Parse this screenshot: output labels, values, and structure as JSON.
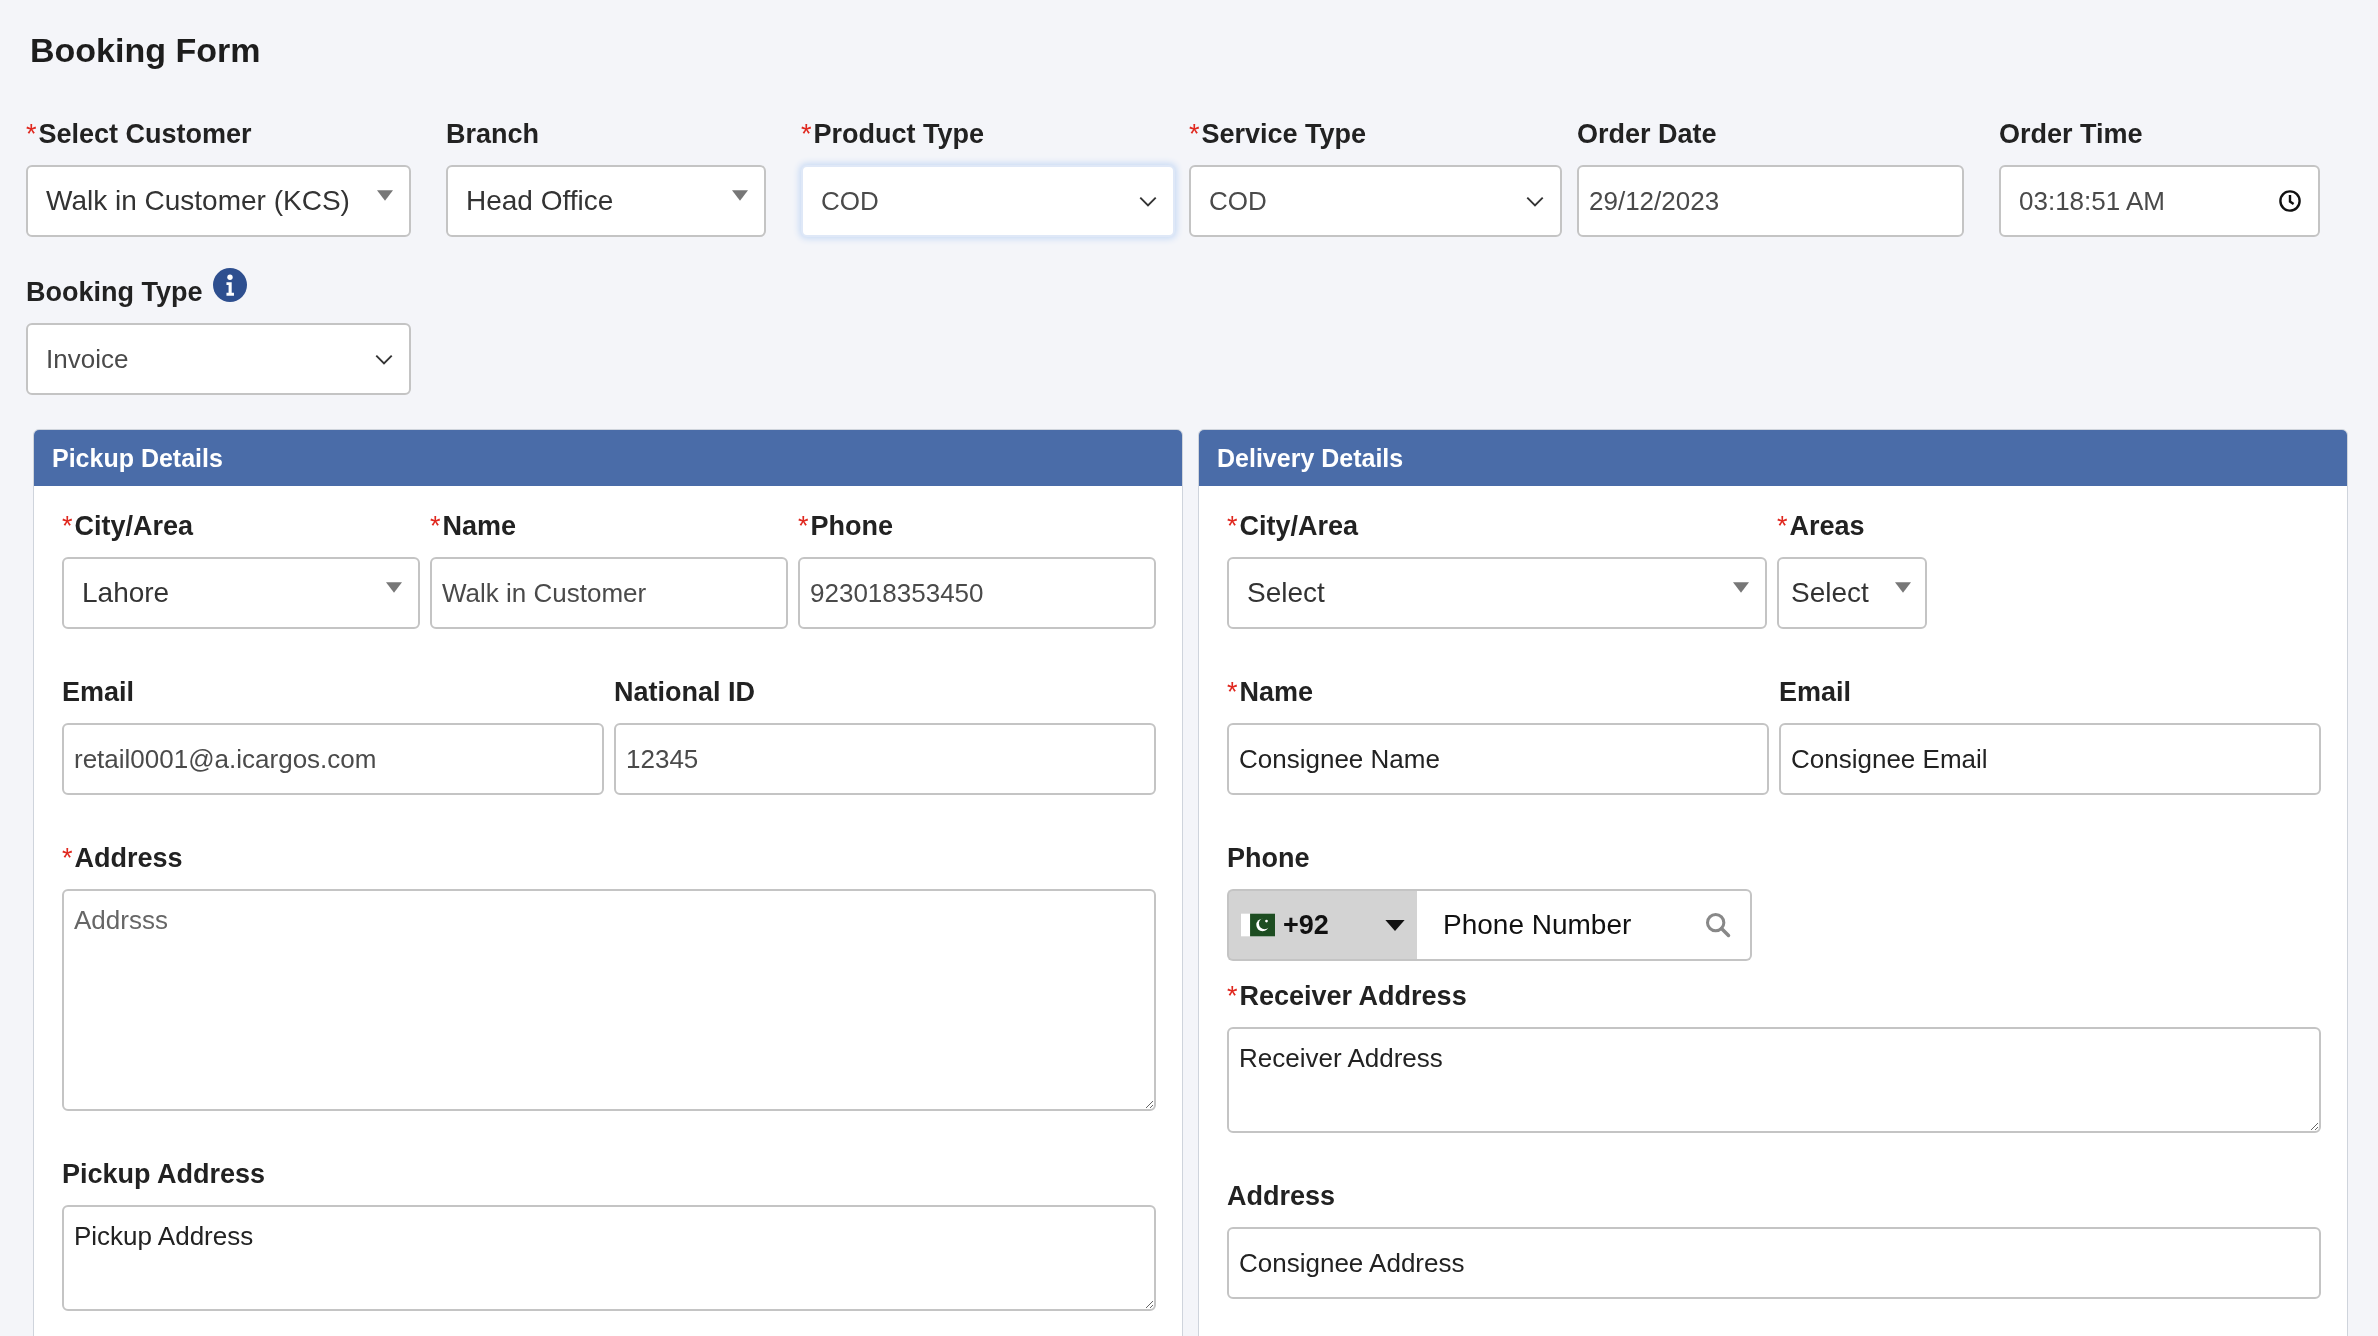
{
  "title": "Booking Form",
  "header_fields": [
    {
      "label": "Select Customer",
      "mark": "*",
      "kind": "dropdown",
      "value": "Walk in Customer (KCS)",
      "focused": false,
      "info": false
    },
    {
      "label": "Branch",
      "kind": "dropdown",
      "value": "Head Office",
      "focused": false,
      "info": false
    },
    {
      "label": "Product Type",
      "mark": "*",
      "kind": "select",
      "value": "COD",
      "focused": true,
      "info": false
    },
    {
      "label": "Service Type",
      "mark": "*",
      "kind": "select",
      "value": "COD",
      "focused": false,
      "info": false
    },
    {
      "label": "Order Date",
      "kind": "text",
      "value": "29/12/2023",
      "focused": false,
      "info": false
    },
    {
      "label": "Order Time",
      "kind": "time",
      "value": "03:18:51 AM",
      "focused": false,
      "info": false
    },
    {
      "label": "Booking Type",
      "kind": "select",
      "value": "Invoice",
      "focused": false,
      "info": true
    }
  ],
  "panels": [
    {
      "title": "Pickup Details",
      "rows": [
        [
          {
            "label": "City/Area",
            "mark": "*",
            "kind": "dropdown",
            "value": "Lahore"
          },
          {
            "label": "Name",
            "mark": "*",
            "kind": "text",
            "value": "Walk in Customer"
          },
          {
            "label": "Phone",
            "mark": "*",
            "kind": "text",
            "value": "923018353450"
          }
        ],
        [
          {
            "label": "Email",
            "kind": "text",
            "value": "retail0001@a.icargos.com"
          },
          {
            "label": "National ID",
            "kind": "text",
            "value": "12345"
          }
        ],
        [
          {
            "label": "Address",
            "mark": "*",
            "kind": "textarea_tall",
            "placeholder": "Addrsss"
          }
        ],
        [
          {
            "label": "Pickup Address",
            "kind": "textarea",
            "placeholder": "Pickup Address"
          }
        ]
      ]
    },
    {
      "title": "Delivery Details",
      "rows": [
        [
          {
            "label": "City/Area",
            "mark": "*",
            "kind": "dropdown",
            "value": "Select"
          },
          {
            "label": "Areas",
            "mark": "*",
            "kind": "dropdown_small",
            "value": "Select"
          }
        ],
        [
          {
            "label": "Name",
            "mark": "*",
            "kind": "text",
            "placeholder": "Consignee Name"
          },
          {
            "label": "Email",
            "kind": "text",
            "placeholder": "Consignee Email"
          }
        ],
        [
          {
            "label": "Phone",
            "kind": "phone",
            "code": "+92",
            "placeholder": "Phone Number"
          }
        ],
        [
          {
            "label": "Receiver Address",
            "mark": "*",
            "kind": "textarea",
            "placeholder": "Receiver Address"
          }
        ],
        [
          {
            "label": "Address",
            "kind": "text",
            "placeholder": "Consignee Address"
          }
        ]
      ]
    }
  ]
}
